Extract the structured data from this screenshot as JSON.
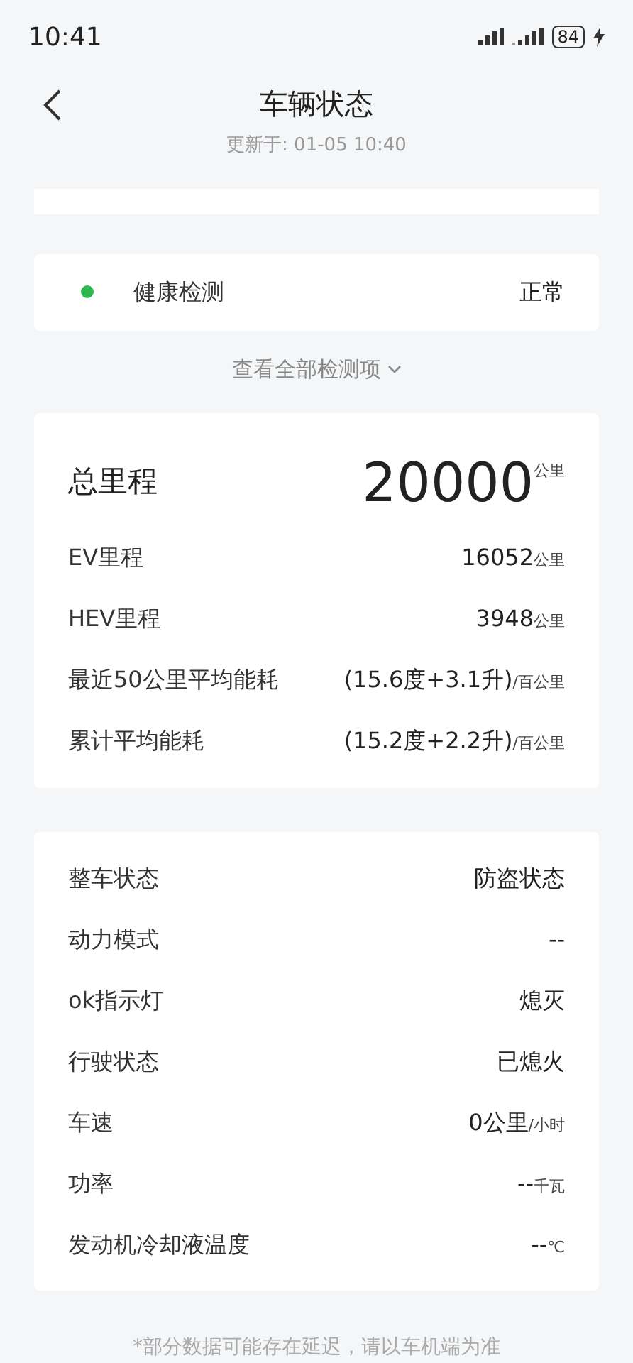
{
  "status_bar": {
    "time": "10:41",
    "battery": "84"
  },
  "header": {
    "title": "车辆状态",
    "updated": "更新于: 01-05 10:40"
  },
  "health": {
    "label": "健康检测",
    "value": "正常",
    "color": "#2db84d",
    "link": "查看全部检测项"
  },
  "mileage": {
    "label": "总里程",
    "value": "20000",
    "unit": "公里",
    "rows": [
      {
        "label": "EV里程",
        "value": "16052",
        "unit": "公里"
      },
      {
        "label": "HEV里程",
        "value": "3948",
        "unit": "公里"
      },
      {
        "label": "最近50公里平均能耗",
        "value": "(15.6度+3.1升)",
        "unit": "/百公里"
      },
      {
        "label": "累计平均能耗",
        "value": "(15.2度+2.2升)",
        "unit": "/百公里"
      }
    ]
  },
  "status_rows": [
    {
      "label": "整车状态",
      "value": "防盗状态"
    },
    {
      "label": "动力模式",
      "value": "--"
    },
    {
      "label": "ok指示灯",
      "value": "熄灭"
    },
    {
      "label": "行驶状态",
      "value": "已熄火"
    },
    {
      "label": "车速",
      "value": "0公里",
      "unit": "/小时"
    },
    {
      "label": "功率",
      "value": "--",
      "unit": "千瓦"
    },
    {
      "label": "发动机冷却液温度",
      "value": "--",
      "unit": "℃"
    }
  ],
  "footer": "*部分数据可能存在延迟，请以车机端为准"
}
